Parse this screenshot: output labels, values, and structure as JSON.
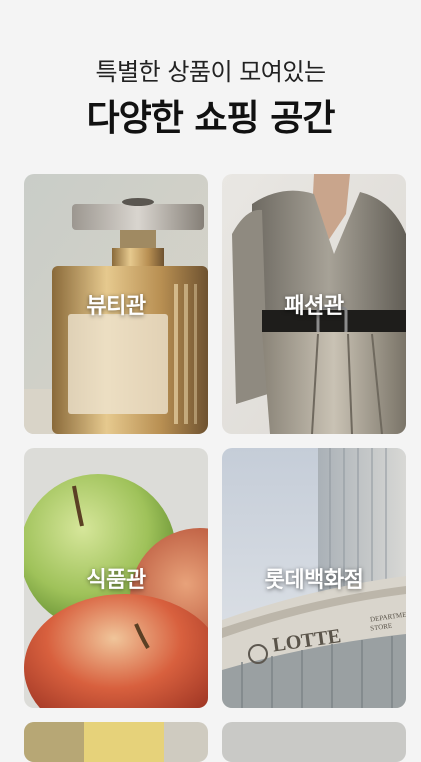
{
  "header": {
    "subtitle": "특별한 상품이 모여있는",
    "title": "다양한 쇼핑 공간"
  },
  "categories": [
    {
      "label": "뷰티관",
      "image": "perfume-bottle-image"
    },
    {
      "label": "패션관",
      "image": "fashion-model-image"
    },
    {
      "label": "식품관",
      "image": "apples-image"
    },
    {
      "label": "롯데백화점",
      "image": "department-store-building-image"
    }
  ],
  "store_sign": {
    "brand": "LOTTE",
    "sub_line_1": "DEPARTMENT",
    "sub_line_2": "STORE"
  },
  "colors": {
    "background": "#f4f4f4",
    "text": "#111111",
    "label": "#ffffff"
  }
}
